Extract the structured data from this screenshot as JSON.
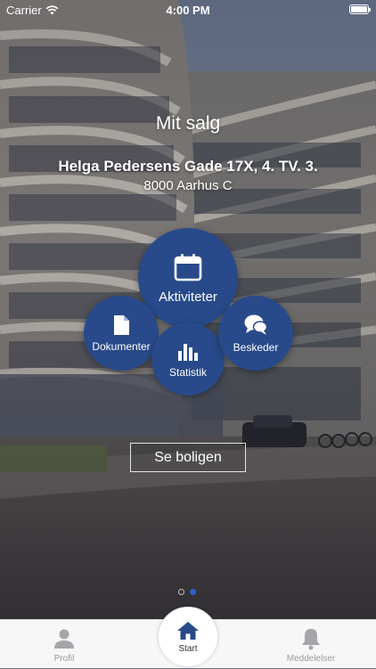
{
  "status_bar": {
    "carrier": "Carrier",
    "time": "4:00 PM"
  },
  "header": {
    "title": "Mit salg",
    "address": "Helga Pedersens Gade 17X, 4. TV. 3.",
    "city": "8000 Aarhus C"
  },
  "menu": {
    "activities": "Aktiviteter",
    "documents": "Dokumenter",
    "statistics": "Statistik",
    "messages": "Beskeder"
  },
  "see_home_label": "Se boligen",
  "page_indicator": {
    "pages": 2,
    "current": 2
  },
  "tab_bar": {
    "profile": "Profil",
    "start": "Start",
    "notifications": "Meddelelser"
  },
  "colors": {
    "bubble": "#284a8a",
    "active_dot": "#2b5fd0",
    "tab_inactive": "#9a9a9f"
  }
}
